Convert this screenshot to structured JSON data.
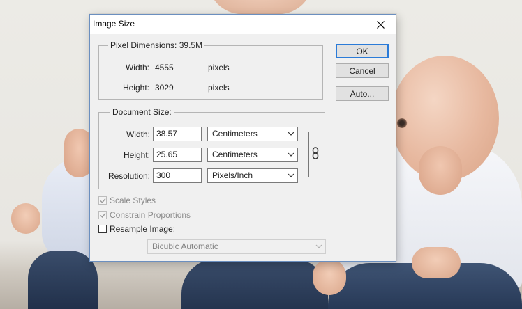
{
  "dialog": {
    "title": "Image Size",
    "buttons": {
      "ok": "OK",
      "cancel": "Cancel",
      "auto": "Auto..."
    }
  },
  "pixel_dimensions": {
    "legend": "Pixel Dimensions:",
    "size": "39.5M",
    "width_label": "Width:",
    "width_value": "4555",
    "width_unit": "pixels",
    "height_label": "Height:",
    "height_value": "3029",
    "height_unit": "pixels"
  },
  "document_size": {
    "legend": "Document Size:",
    "width_label": "Width:",
    "width_value": "38.57",
    "width_unit": "Centimeters",
    "height_label": "Height:",
    "height_value": "25.65",
    "height_unit": "Centimeters",
    "resolution_label": "Resolution:",
    "resolution_value": "300",
    "resolution_unit": "Pixels/Inch"
  },
  "options": {
    "scale_styles": {
      "label": "Scale Styles",
      "checked": true,
      "enabled": false
    },
    "constrain_proportions": {
      "label": "Constrain Proportions",
      "checked": true,
      "enabled": false
    },
    "resample_image": {
      "label": "Resample Image:",
      "checked": false,
      "enabled": true
    },
    "resample_method": "Bicubic Automatic"
  },
  "icons": {
    "close": "close-icon",
    "chain": "chain-link-icon",
    "dropdown": "chevron-down-icon",
    "check": "checkmark-icon"
  }
}
